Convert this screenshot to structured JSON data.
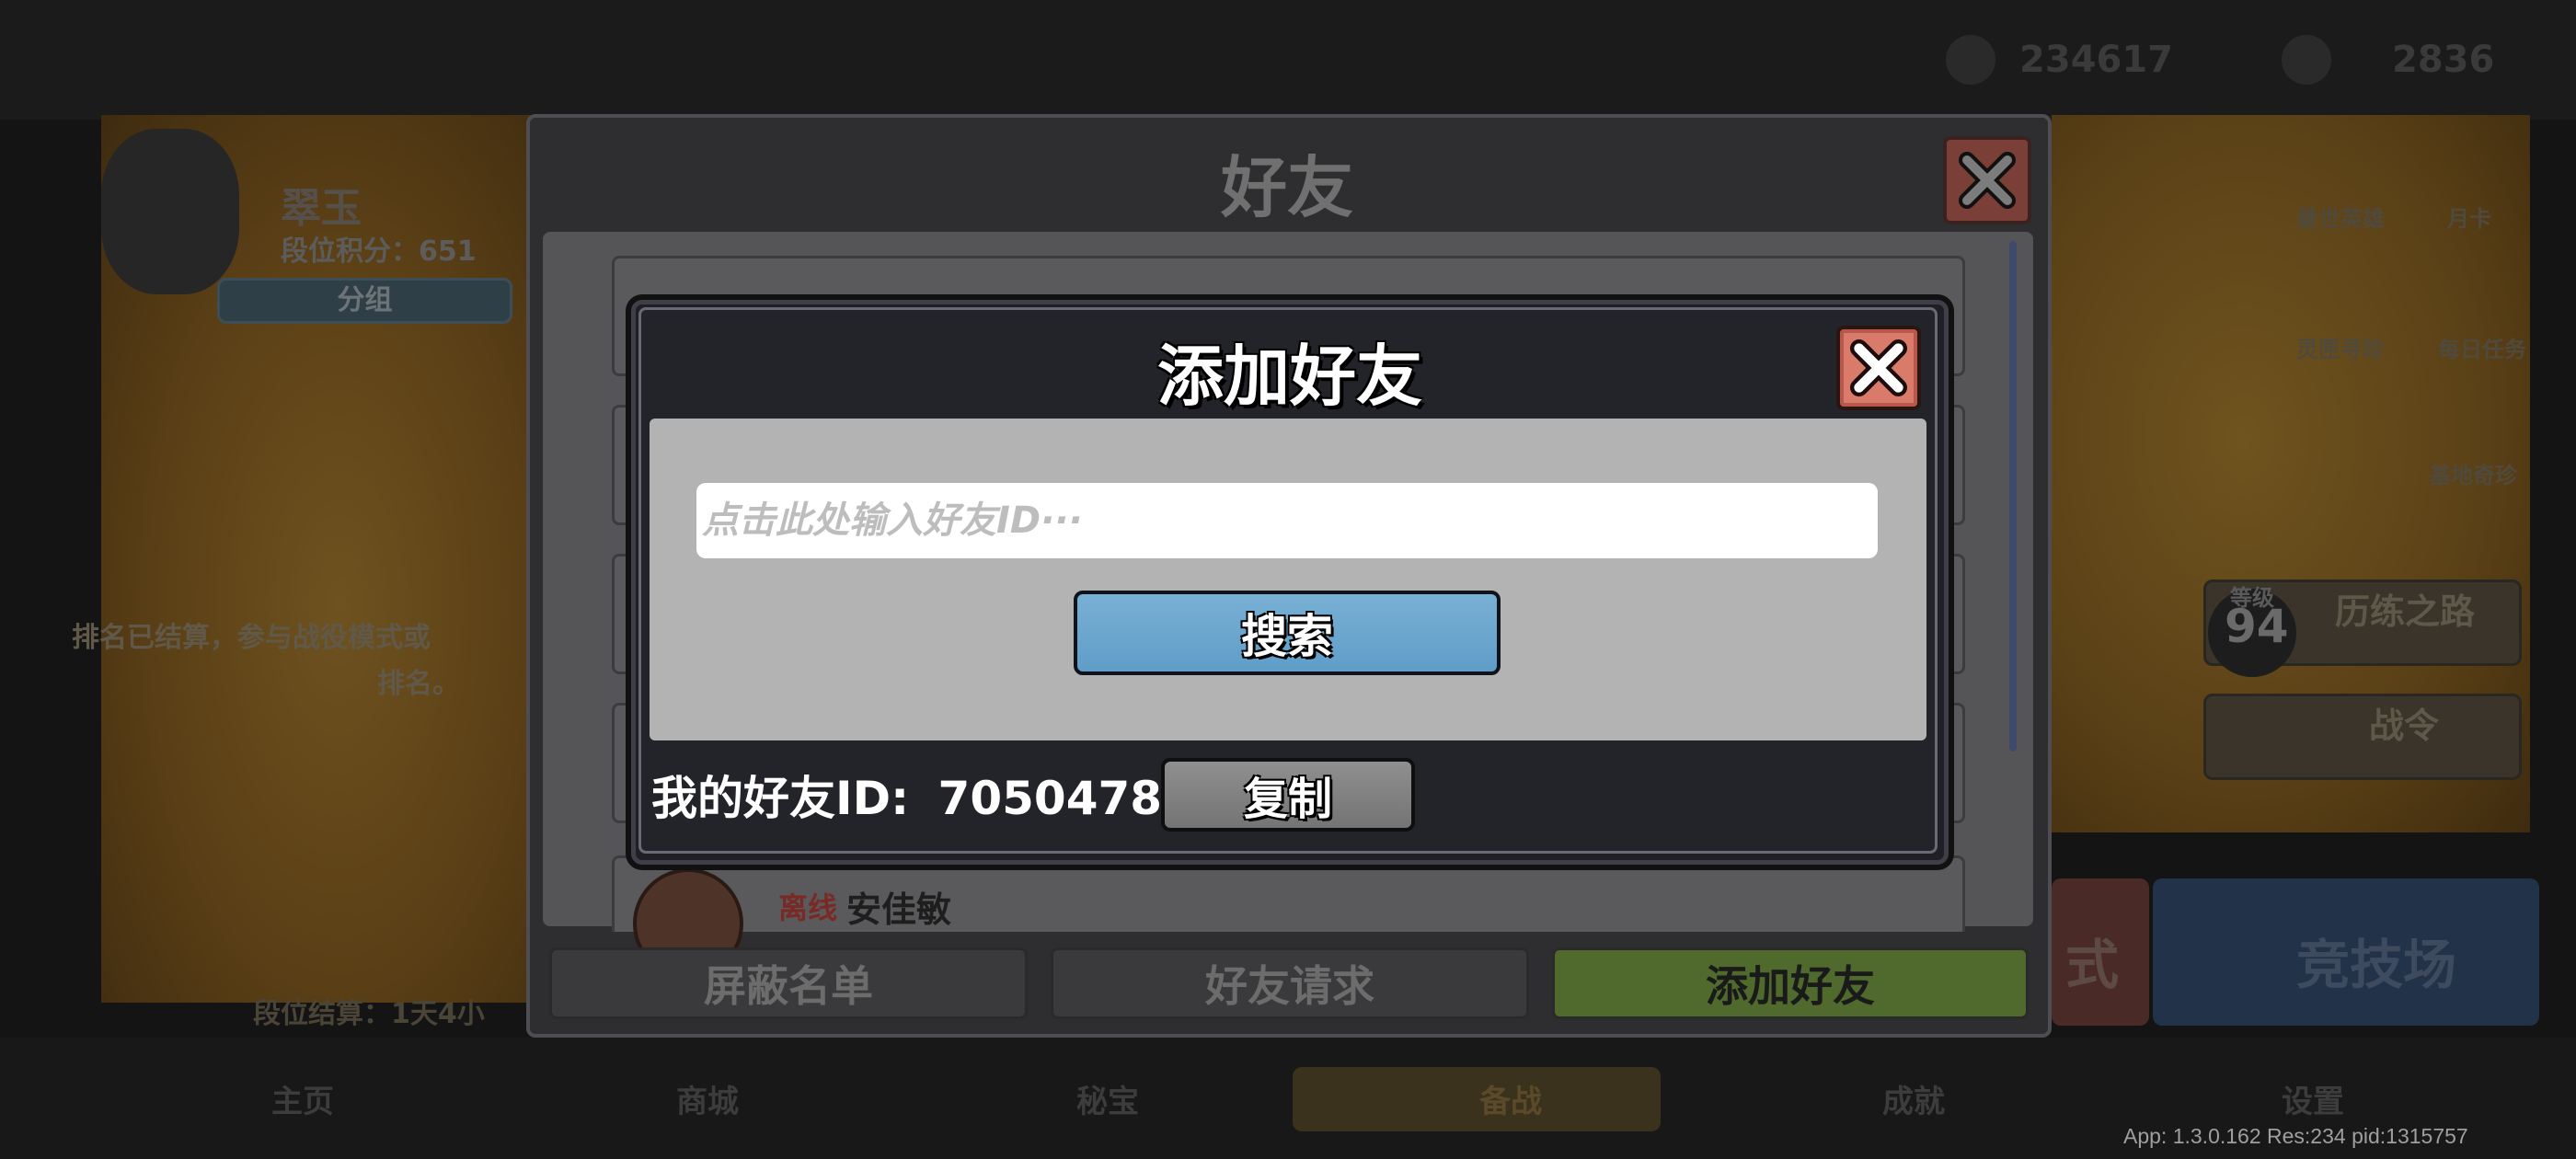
{
  "background": {
    "player_name": "翠玉",
    "rank_score": "段位积分：651",
    "group_button": "分组",
    "season_notice_line1": "排名已结算，参与战役模式或",
    "season_notice_line2": "排名。",
    "rank_settle": "段位结算：1天4小",
    "currency_1": "234617",
    "currency_2": "2836",
    "side_menu": [
      "曼世英雄",
      "月卡",
      "灵匣寻珍",
      "每日任务",
      "基地奇珍"
    ],
    "level_label": "等级",
    "level_value": "94",
    "trial_road": "历练之路",
    "battle_pass": "战令",
    "mode_fragment": "式",
    "arena": "竞技场",
    "nav": [
      "主页",
      "商城",
      "秘宝",
      "备战",
      "成就",
      "设置"
    ],
    "build_info": "App: 1.3.0.162 Res:234 pid:1315757"
  },
  "friends_panel": {
    "title": "好友",
    "friend_row": {
      "status": "离线",
      "name": "安佳敏"
    },
    "tabs": [
      {
        "label": "屏蔽名单",
        "active": false
      },
      {
        "label": "好友请求",
        "active": false
      },
      {
        "label": "添加好友",
        "active": true
      }
    ]
  },
  "add_friend_dialog": {
    "title": "添加好友",
    "input_placeholder": "点击此处输入好友ID···",
    "search_label": "搜索",
    "my_id_label": "我的好友ID:",
    "my_id_value": "70504788",
    "copy_label": "复制"
  },
  "colors": {
    "search_button": "#6aa7cf",
    "close_button": "#d97a6a",
    "active_tab": "#4f6a2c"
  }
}
